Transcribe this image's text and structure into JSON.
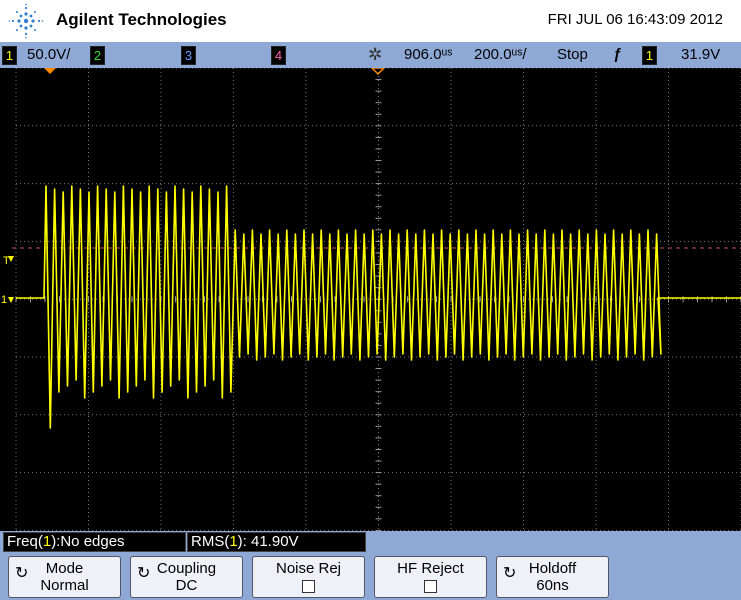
{
  "header": {
    "brand": "Agilent Technologies",
    "datetime": "FRI JUL 06 16:43:09 2012"
  },
  "status": {
    "ch1_num": "1",
    "ch1_scale": "50.0V/",
    "ch2_num": "2",
    "ch3_num": "3",
    "ch4_num": "4",
    "time_delay": "906.0ᵘˢ",
    "time_scale": "200.0ᵘˢ/",
    "run_state": "Stop",
    "trigger_slope": "ƒ",
    "trigger_channel": "1",
    "trigger_level": "31.9V"
  },
  "markers": {
    "trigger_level": "T",
    "ground_ref": "1"
  },
  "measurements": {
    "freq_prefix": "Freq(",
    "freq_ch": "1",
    "freq_suffix": "):No edges",
    "rms_prefix": "RMS(",
    "rms_ch": "1",
    "rms_suffix": "): 41.90V"
  },
  "softkeys": [
    {
      "line1": "Mode",
      "line2": "Normal",
      "curl": true
    },
    {
      "line1": "Coupling",
      "line2": "DC",
      "curl": true
    },
    {
      "line1": "Noise Rej",
      "checkbox": true
    },
    {
      "line1": "HF Reject",
      "checkbox": true
    },
    {
      "line1": "Holdoff",
      "line2": "60ns",
      "curl": true
    }
  ],
  "colors": {
    "trace": "#ffff00",
    "bar": "#8ea9d6",
    "grid": "#888888"
  },
  "icons": {
    "logo": "agilent-spark-icon",
    "acquire": "acquire-spark-icon",
    "knob": "curl-arrow-icon"
  }
}
